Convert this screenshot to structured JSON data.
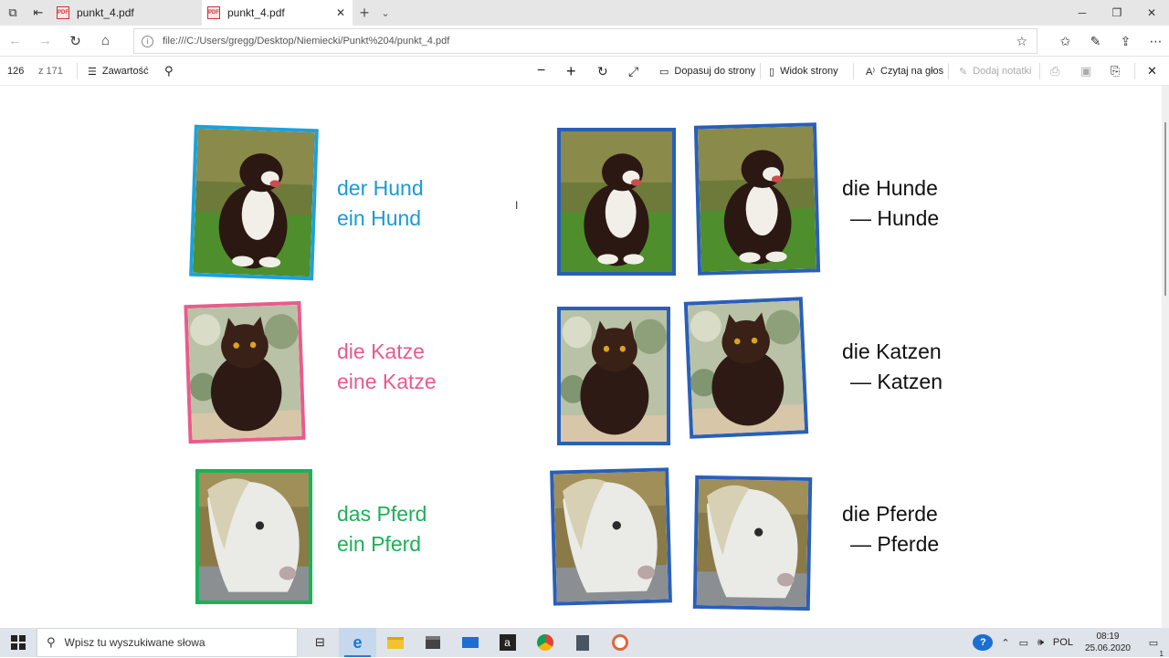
{
  "browser": {
    "tabs": [
      {
        "label": "punkt_4.pdf",
        "active": false
      },
      {
        "label": "punkt_4.pdf",
        "active": true
      }
    ],
    "url": "file:///C:/Users/gregg/Desktop/Niemiecki/Punkt%204/punkt_4.pdf"
  },
  "pdf_toolbar": {
    "page_number": "126",
    "page_total": "z 171",
    "contents_label": "Zawartość",
    "fit_label": "Dopasuj do strony",
    "view_label": "Widok strony",
    "read_aloud_label": "Czytaj na głos",
    "add_notes_label": "Dodaj notatki"
  },
  "vocab": {
    "dog": {
      "singular_def": "der Hund",
      "singular_indef": "ein Hund",
      "plural_def": "die Hunde",
      "plural_indef": "— Hunde",
      "color": "#1a9ad6"
    },
    "cat": {
      "singular_def": "die Katze",
      "singular_indef": "eine Katze",
      "plural_def": "die Katzen",
      "plural_indef": "— Katzen",
      "color": "#e85a8c"
    },
    "horse": {
      "singular_def": "das Pferd",
      "singular_indef": "ein Pferd",
      "plural_def": "die Pferde",
      "plural_indef": "— Pferde",
      "color": "#1faf57"
    }
  },
  "taskbar": {
    "search_placeholder": "Wpisz tu wyszukiwane słowa",
    "language": "POL",
    "time": "08:19",
    "date": "25.06.2020",
    "notification_count": "1"
  }
}
